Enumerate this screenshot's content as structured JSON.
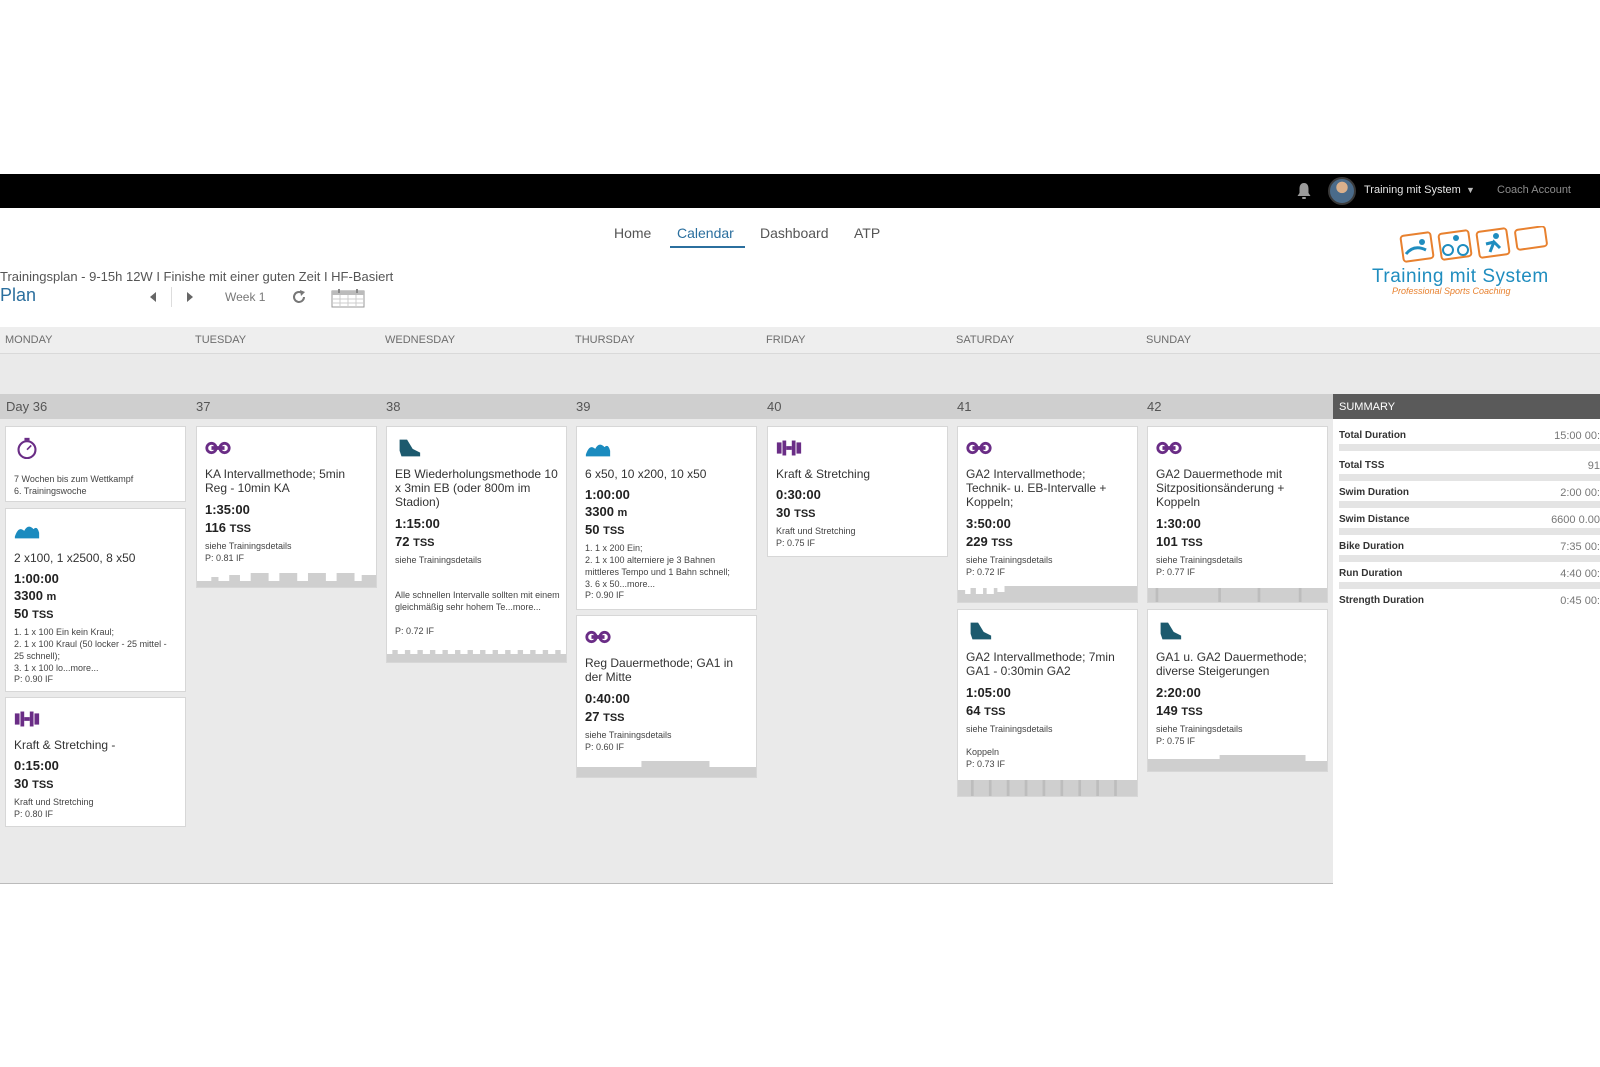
{
  "topbar": {
    "user_name": "Training mit System",
    "account_type": "Coach Account"
  },
  "nav": {
    "items": [
      "Home",
      "Calendar",
      "Dashboard",
      "ATP"
    ],
    "active": "Calendar"
  },
  "plan": {
    "title": "Trainingsplan - 9-15h 12W I Finishe mit einer guten Zeit I HF-Basiert",
    "heading": "Plan",
    "week_label": "Week 1"
  },
  "logo": {
    "text": "Training mit System",
    "sub": "Professional Sports Coaching"
  },
  "days": [
    "MONDAY",
    "TUESDAY",
    "WEDNESDAY",
    "THURSDAY",
    "FRIDAY",
    "SATURDAY",
    "SUNDAY"
  ],
  "day_numbers": [
    "Day 36",
    "37",
    "38",
    "39",
    "40",
    "41",
    "42"
  ],
  "summary": {
    "title": "SUMMARY",
    "rows": [
      {
        "label": "Total Duration",
        "value": "15:00 00:"
      },
      {
        "label": "Total TSS",
        "value": "91"
      },
      {
        "label": "Swim Duration",
        "value": "2:00 00:"
      },
      {
        "label": "Swim Distance",
        "value": "6600 0.00"
      },
      {
        "label": "Bike Duration",
        "value": "7:35 00:"
      },
      {
        "label": "Run Duration",
        "value": "4:40 00:"
      },
      {
        "label": "Strength Duration",
        "value": "0:45 00:"
      }
    ]
  },
  "cards": {
    "mon_event": {
      "icon": "stopwatch-icon",
      "line1": "7 Wochen bis zum Wettkampf",
      "line2": "6. Trainingswoche"
    },
    "mon_swim": {
      "icon": "swim-icon",
      "title": "2 x100, 1 x2500, 8 x50",
      "duration": "1:00:00",
      "distance": "3300",
      "distance_unit": "m",
      "tss": "50",
      "tss_unit": "TSS",
      "desc": "1. 1 x 100 Ein kein Kraul;\n2. 1 x 100 Kraul (50 locker - 25 mittel - 25 schnell);\n3. 1 x 100 lo...more...",
      "if": "P: 0.90 IF"
    },
    "mon_strength": {
      "icon": "dumbbell-icon",
      "title": "Kraft & Stretching -",
      "duration": "0:15:00",
      "tss": "30",
      "tss_unit": "TSS",
      "desc": "Kraft und Stretching",
      "if": "P: 0.80 IF"
    },
    "tue_bike": {
      "icon": "bike-icon",
      "title": "KA Intervallmethode; 5min Reg - 10min KA",
      "duration": "1:35:00",
      "tss": "116",
      "tss_unit": "TSS",
      "desc": "siehe Trainingsdetails",
      "if": "P: 0.81 IF"
    },
    "wed_run": {
      "icon": "run-icon",
      "title": "EB Wiederholungsmethode 10 x 3min EB (oder 800m im Stadion)",
      "duration": "1:15:00",
      "tss": "72",
      "tss_unit": "TSS",
      "desc": "siehe Trainingsdetails",
      "desc2": "Alle schnellen Intervalle sollten mit einem gleichmäßig sehr hohem Te...more...",
      "if": "P: 0.72 IF"
    },
    "thu_swim": {
      "icon": "swim-icon",
      "title": "6 x50, 10 x200, 10 x50",
      "duration": "1:00:00",
      "distance": "3300",
      "distance_unit": "m",
      "tss": "50",
      "tss_unit": "TSS",
      "desc": "1. 1 x 200 Ein;\n2. 1 x 100 alterniere je 3 Bahnen mittleres Tempo und 1 Bahn schnell;\n3. 6 x 50...more...",
      "if": "P: 0.90 IF"
    },
    "thu_bike": {
      "icon": "bike-icon",
      "title": "Reg Dauermethode; GA1 in der Mitte",
      "duration": "0:40:00",
      "tss": "27",
      "tss_unit": "TSS",
      "desc": "siehe Trainingsdetails",
      "if": "P: 0.60 IF"
    },
    "fri_strength": {
      "icon": "dumbbell-icon",
      "title": "Kraft & Stretching",
      "duration": "0:30:00",
      "tss": "30",
      "tss_unit": "TSS",
      "desc": "Kraft und Stretching",
      "if": "P: 0.75 IF"
    },
    "sat_bike": {
      "icon": "bike-icon",
      "title": "GA2 Intervallmethode; Technik- u. EB-Intervalle + Koppeln;",
      "duration": "3:50:00",
      "tss": "229",
      "tss_unit": "TSS",
      "desc": "siehe Trainingsdetails",
      "if": "P: 0.72 IF"
    },
    "sat_run": {
      "icon": "run-icon",
      "title": "GA2 Intervallmethode; 7min GA1 - 0:30min GA2",
      "duration": "1:05:00",
      "tss": "64",
      "tss_unit": "TSS",
      "desc": "siehe Trainingsdetails",
      "desc2": "Koppeln",
      "if": "P: 0.73 IF"
    },
    "sun_bike": {
      "icon": "bike-icon",
      "title": "GA2 Dauermethode mit Sitzpositionsänderung + Koppeln",
      "duration": "1:30:00",
      "tss": "101",
      "tss_unit": "TSS",
      "desc": "siehe Trainingsdetails",
      "if": "P: 0.77 IF"
    },
    "sun_run": {
      "icon": "run-icon",
      "title": "GA1 u. GA2 Dauermethode; diverse Steigerungen",
      "duration": "2:20:00",
      "tss": "149",
      "tss_unit": "TSS",
      "desc": "siehe Trainingsdetails",
      "if": "P: 0.75 IF"
    }
  },
  "colors": {
    "accent": "#2b6f9e",
    "bike": "#6a2d86",
    "swim": "#1b8bbf",
    "run": "#1c5a6e",
    "strength": "#6a2d86",
    "logo_orange": "#e8812f"
  }
}
